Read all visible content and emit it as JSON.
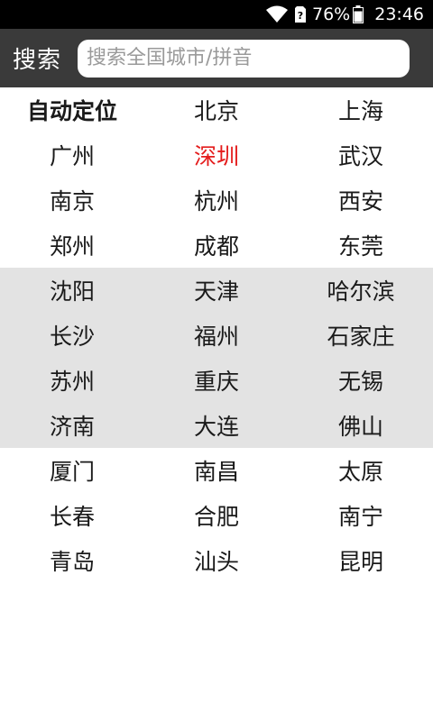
{
  "status_bar": {
    "battery_percent": "76%",
    "time": "23:46",
    "icons": [
      "wifi-icon",
      "sim-alert-icon",
      "battery-icon"
    ],
    "icon_color": "#ffffff",
    "background": "#000000"
  },
  "search": {
    "label": "搜索",
    "placeholder": "搜索全国城市/拼音",
    "bar_color": "#3a3a3a"
  },
  "colors": {
    "selected_city": "#e41c1c",
    "shaded_row": "#e3e3e3"
  },
  "selected_city": "深圳",
  "shaded_rows": [
    4,
    5,
    6,
    7
  ],
  "city_rows": [
    [
      "自动定位",
      "北京",
      "上海"
    ],
    [
      "广州",
      "深圳",
      "武汉"
    ],
    [
      "南京",
      "杭州",
      "西安"
    ],
    [
      "郑州",
      "成都",
      "东莞"
    ],
    [
      "沈阳",
      "天津",
      "哈尔滨"
    ],
    [
      "长沙",
      "福州",
      "石家庄"
    ],
    [
      "苏州",
      "重庆",
      "无锡"
    ],
    [
      "济南",
      "大连",
      "佛山"
    ],
    [
      "厦门",
      "南昌",
      "太原"
    ],
    [
      "长春",
      "合肥",
      "南宁"
    ],
    [
      "青岛",
      "汕头",
      "昆明"
    ]
  ]
}
